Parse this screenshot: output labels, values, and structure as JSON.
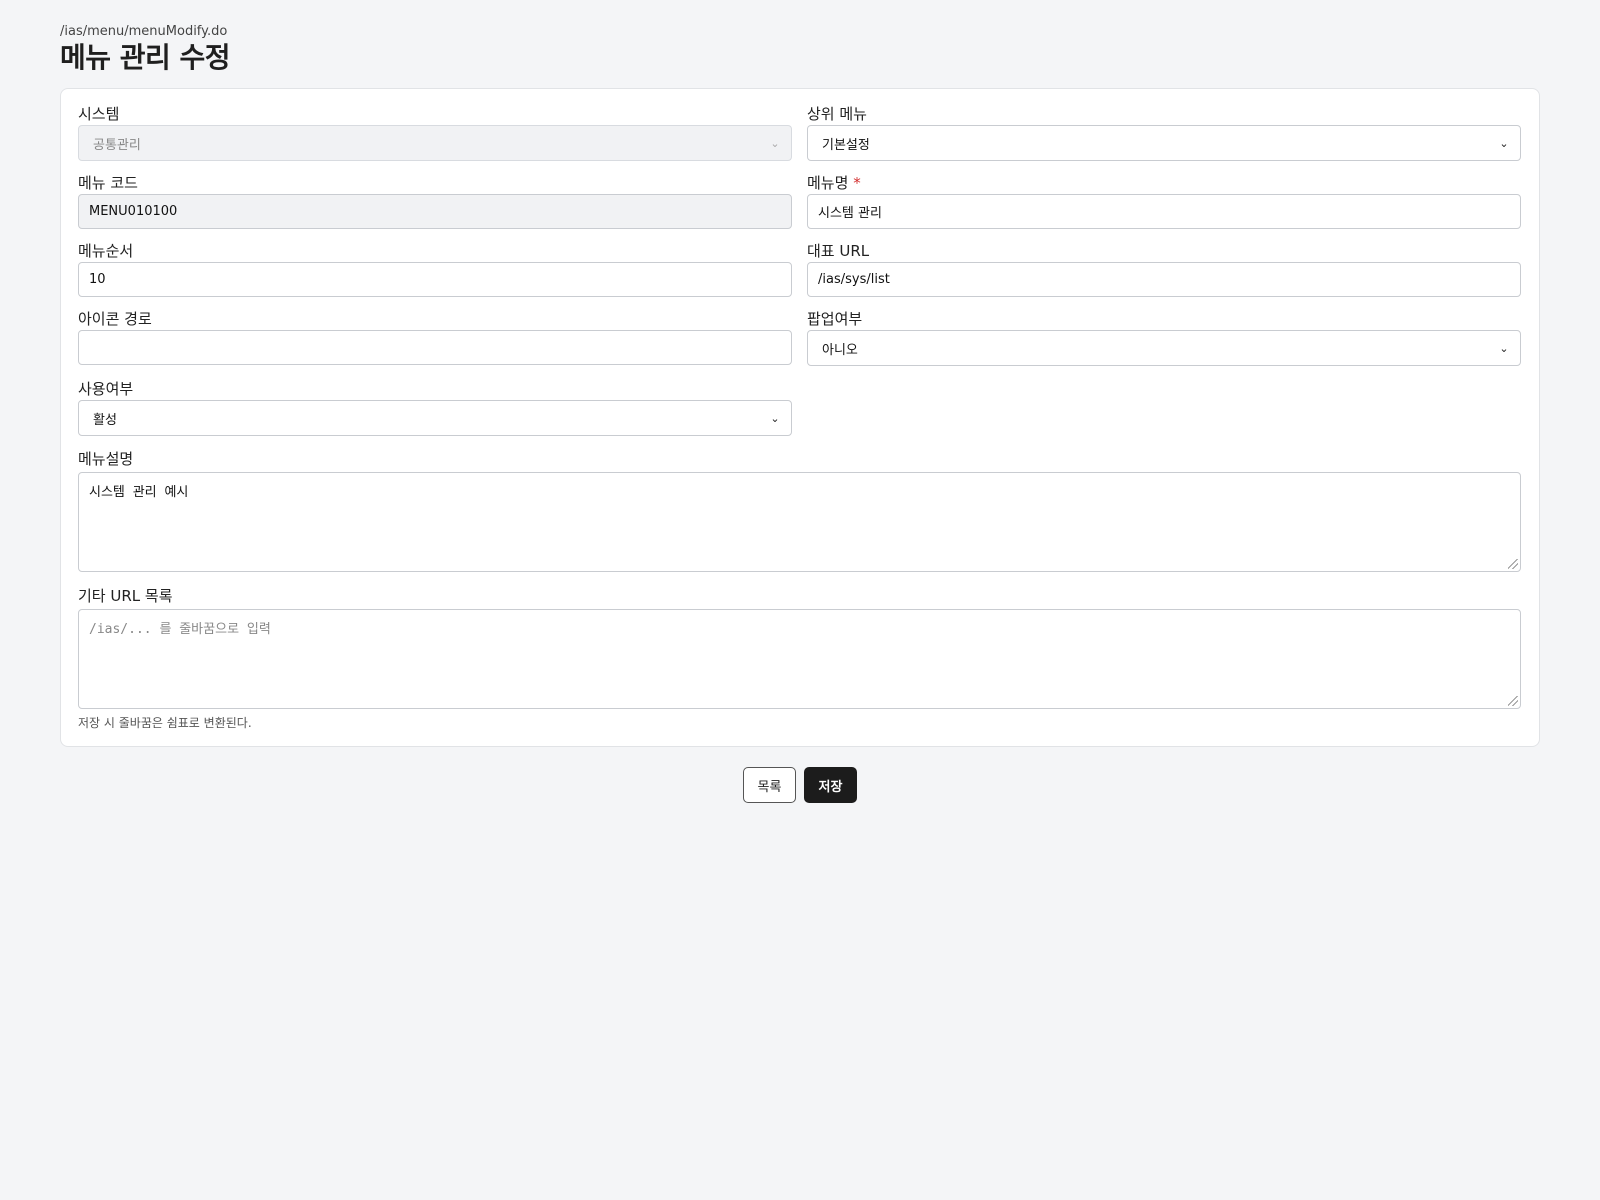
{
  "header": {
    "path": "/ias/menu/menuModify.do",
    "title": "메뉴 관리 수정"
  },
  "form": {
    "system": {
      "label": "시스템",
      "value": "공통관리"
    },
    "parent_menu": {
      "label": "상위 메뉴",
      "value": "기본설정"
    },
    "menu_code": {
      "label": "메뉴 코드",
      "value": "MENU010100"
    },
    "menu_name": {
      "label": "메뉴명",
      "required_mark": "*",
      "value": "시스템 관리"
    },
    "menu_order": {
      "label": "메뉴순서",
      "value": "10"
    },
    "main_url": {
      "label": "대표 URL",
      "value": "/ias/sys/list"
    },
    "icon_path": {
      "label": "아이콘 경로",
      "value": ""
    },
    "popup": {
      "label": "팝업여부",
      "value": "아니오"
    },
    "use_yn": {
      "label": "사용여부",
      "value": "활성"
    },
    "description": {
      "label": "메뉴설명",
      "value": "시스템 관리 예시"
    },
    "other_urls": {
      "label": "기타 URL 목록",
      "placeholder": "/ias/... 를 줄바꿈으로 입력",
      "hint": "저장 시 줄바꿈은 쉼표로 변환된다."
    }
  },
  "buttons": {
    "list_label": "목록",
    "save_label": "저장"
  },
  "icons": {
    "select_chevron": "chevron-down-icon",
    "resize_grip": "resize-grip-icon"
  },
  "colors": {
    "background": "#f4f5f7",
    "required": "#d32f2f",
    "primary_button": "#1c1c1c"
  }
}
